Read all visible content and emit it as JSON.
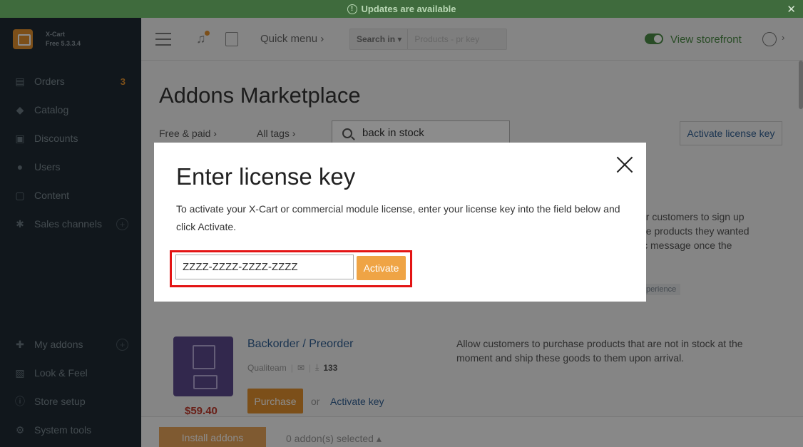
{
  "banner": {
    "text": "Updates are available",
    "close": "✕"
  },
  "sidebar": {
    "brand": {
      "name": "X-Cart",
      "version": "Free 5.3.3.4"
    },
    "items": [
      {
        "label": "Orders",
        "icon": "orders-icon",
        "badge": "3"
      },
      {
        "label": "Catalog",
        "icon": "tag-icon"
      },
      {
        "label": "Discounts",
        "icon": "gift-icon"
      },
      {
        "label": "Users",
        "icon": "users-icon"
      },
      {
        "label": "Content",
        "icon": "content-icon"
      },
      {
        "label": "Sales channels",
        "icon": "asterisk-icon",
        "plus": "+"
      },
      {
        "label": "My addons",
        "icon": "puzzle-icon",
        "plus": "+"
      },
      {
        "label": "Look & Feel",
        "icon": "image-icon"
      },
      {
        "label": "Store setup",
        "icon": "info-icon"
      },
      {
        "label": "System tools",
        "icon": "gear-icon"
      }
    ]
  },
  "topbar": {
    "quick_menu": "Quick menu ›",
    "search_in": "Search in ▾",
    "search_placeholder": "Products - pr key",
    "view_storefront": "View storefront",
    "avatar_chevron": "›"
  },
  "main": {
    "title": "Addons Marketplace",
    "filter_price": "Free & paid  ›",
    "filter_tags": "All tags  ›",
    "search_value": "back in stock",
    "activate_license_key": "Activate license key",
    "bg_description": "ur customers to sign up\nhe products they wanted\nic message once the",
    "bg_tag": "perience",
    "addon": {
      "name": "Backorder / Preorder",
      "vendor": "Qualiteam",
      "downloads": "133",
      "description": "Allow customers to purchase products that are not in stock at the moment and ship these goods to them upon arrival.",
      "price": "$59.40",
      "purchase_label": "Purchase",
      "or_label": "or",
      "activate_key_label": "Activate key"
    },
    "bottom": {
      "install_label": "Install addons",
      "selected_label": "0 addon(s) selected ▴"
    }
  },
  "modal": {
    "title": "Enter license key",
    "text": "To activate your X-Cart or commercial module license, enter your license key into the field below and click Activate.",
    "input_value": "ZZZZ-ZZZZ-ZZZZ-ZZZZ",
    "activate_label": "Activate",
    "highlight_color": "#e31414"
  }
}
